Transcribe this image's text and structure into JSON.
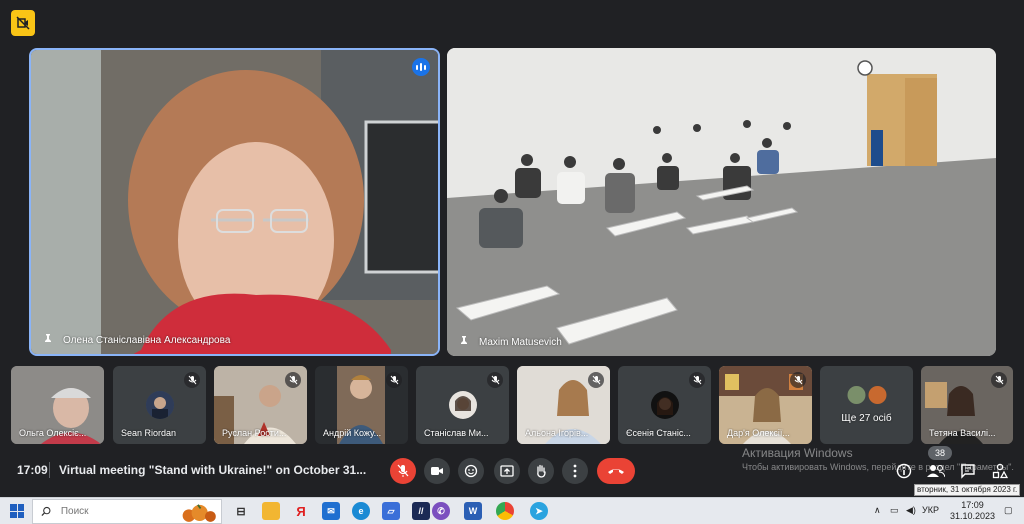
{
  "main": {
    "tiles": [
      {
        "name": "Олена Станіславівна Александрова"
      },
      {
        "name": "Maxim Matusevich"
      }
    ]
  },
  "thumbnails": [
    {
      "name": "Ольга Олексіє..."
    },
    {
      "name": "Sean Riordan"
    },
    {
      "name": "Руслан Рости..."
    },
    {
      "name": "Андрій Кожу..."
    },
    {
      "name": "Станіслав Ми..."
    },
    {
      "name": "Альона Ігорів..."
    },
    {
      "name": "Єсенія Станіс..."
    },
    {
      "name": "Дар'я Олексії..."
    },
    {
      "name": "Ще 27 осіб"
    },
    {
      "name": "Тетяна Василі..."
    }
  ],
  "bottombar": {
    "time": "17:09",
    "meeting_title": "Virtual meeting \"Stand with Ukraine!\" on October 31...",
    "participants_count": "38"
  },
  "watermark": {
    "line1": "Активация Windows",
    "line2": "Чтобы активировать Windows, перейдите в раздел \"Параметры\"."
  },
  "taskbar": {
    "search_placeholder": "Поиск",
    "language": "УКР",
    "clock_time": "17:09",
    "clock_date": "31.10.2023",
    "tooltip": "вторник, 31 октября 2023 г."
  },
  "colors": {
    "background": "#202124",
    "speaking_border": "#8ab4f8",
    "danger": "#ea4335",
    "logo": "#f9c416"
  },
  "icons": [
    "meet-logo-icon",
    "speaking-indicator-icon",
    "pin-icon",
    "mic-off-icon",
    "camera-icon",
    "emoji-icon",
    "present-icon",
    "raise-hand-icon",
    "more-options-icon",
    "hangup-icon",
    "info-icon",
    "people-icon",
    "chat-icon",
    "activities-icon",
    "windows-start-icon",
    "search-icon"
  ]
}
